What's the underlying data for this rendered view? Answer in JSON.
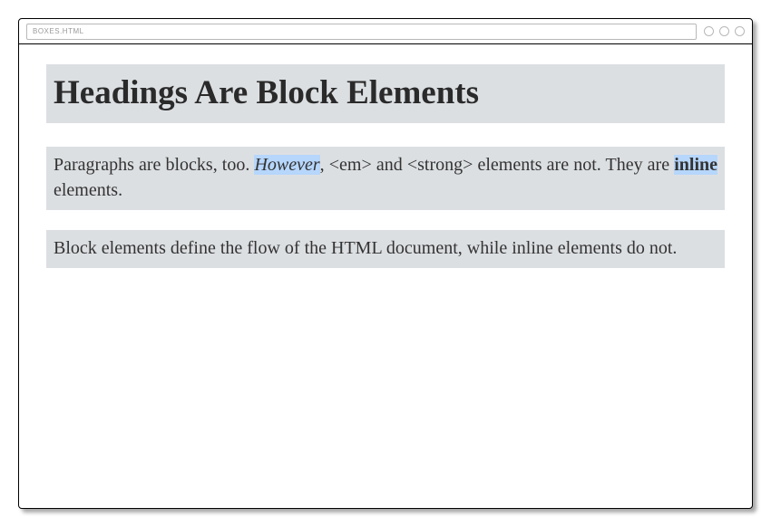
{
  "browser": {
    "url": "BOXES.HTML"
  },
  "content": {
    "heading": "Headings Are Block Elements",
    "p1_seg1": "Paragraphs are blocks, too. ",
    "p1_em": "However",
    "p1_seg2": ", <em> and <strong> elements are not. They are ",
    "p1_strong": "inline",
    "p1_seg3": " elements.",
    "p2": "Block elements define the flow of the HTML document, while inline elements do not."
  }
}
